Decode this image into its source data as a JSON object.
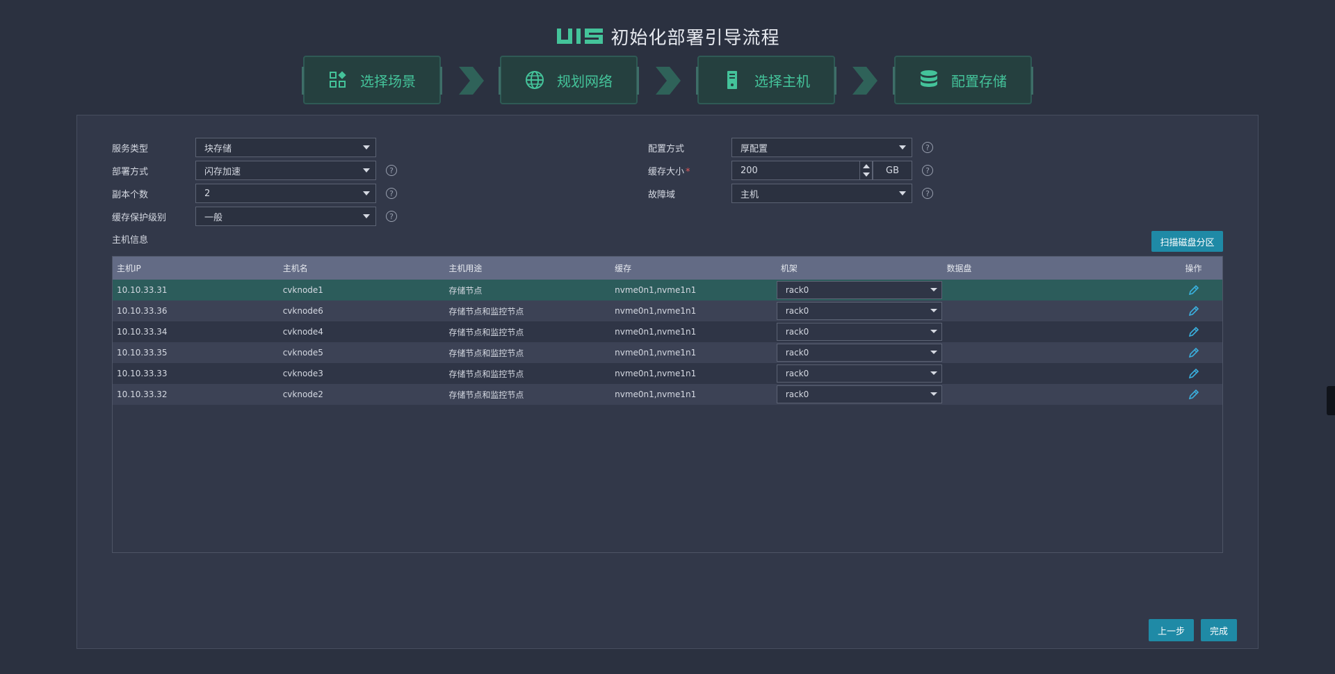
{
  "header": {
    "logo_text": "UIS",
    "title": "初始化部署引导流程"
  },
  "steps": [
    {
      "label": "选择场景",
      "icon": "scene-icon"
    },
    {
      "label": "规划网络",
      "icon": "globe-icon"
    },
    {
      "label": "选择主机",
      "icon": "server-icon"
    },
    {
      "label": "配置存储",
      "icon": "database-icon"
    }
  ],
  "form": {
    "service_type": {
      "label": "服务类型",
      "value": "块存储"
    },
    "deploy_mode": {
      "label": "部署方式",
      "value": "闪存加速"
    },
    "replica_count": {
      "label": "副本个数",
      "value": "2"
    },
    "cache_protect": {
      "label": "缓存保护级别",
      "value": "一般"
    },
    "config_mode": {
      "label": "配置方式",
      "value": "厚配置"
    },
    "cache_size": {
      "label": "缓存大小",
      "required_mark": "*",
      "value": "200",
      "unit": "GB"
    },
    "fault_domain": {
      "label": "故障域",
      "value": "主机"
    },
    "help_glyph": "?"
  },
  "hosts": {
    "section_title": "主机信息",
    "scan_button": "扫描磁盘分区",
    "columns": [
      "主机IP",
      "主机名",
      "主机用途",
      "缓存",
      "机架",
      "数据盘",
      "操作"
    ],
    "rows": [
      {
        "ip": "10.10.33.31",
        "name": "cvknode1",
        "usage": "存储节点",
        "cache": "nvme0n1,nvme1n1",
        "rack": "rack0",
        "data_disk": ""
      },
      {
        "ip": "10.10.33.36",
        "name": "cvknode6",
        "usage": "存储节点和监控节点",
        "cache": "nvme0n1,nvme1n1",
        "rack": "rack0",
        "data_disk": ""
      },
      {
        "ip": "10.10.33.34",
        "name": "cvknode4",
        "usage": "存储节点和监控节点",
        "cache": "nvme0n1,nvme1n1",
        "rack": "rack0",
        "data_disk": ""
      },
      {
        "ip": "10.10.33.35",
        "name": "cvknode5",
        "usage": "存储节点和监控节点",
        "cache": "nvme0n1,nvme1n1",
        "rack": "rack0",
        "data_disk": ""
      },
      {
        "ip": "10.10.33.33",
        "name": "cvknode3",
        "usage": "存储节点和监控节点",
        "cache": "nvme0n1,nvme1n1",
        "rack": "rack0",
        "data_disk": ""
      },
      {
        "ip": "10.10.33.32",
        "name": "cvknode2",
        "usage": "存储节点和监控节点",
        "cache": "nvme0n1,nvme1n1",
        "rack": "rack0",
        "data_disk": ""
      }
    ]
  },
  "footer": {
    "prev_button": "上一步",
    "finish_button": "完成"
  },
  "colors": {
    "accent": "#44c39a",
    "button": "#1f8aa6",
    "background": "#2b3140",
    "panel": "#323849"
  }
}
